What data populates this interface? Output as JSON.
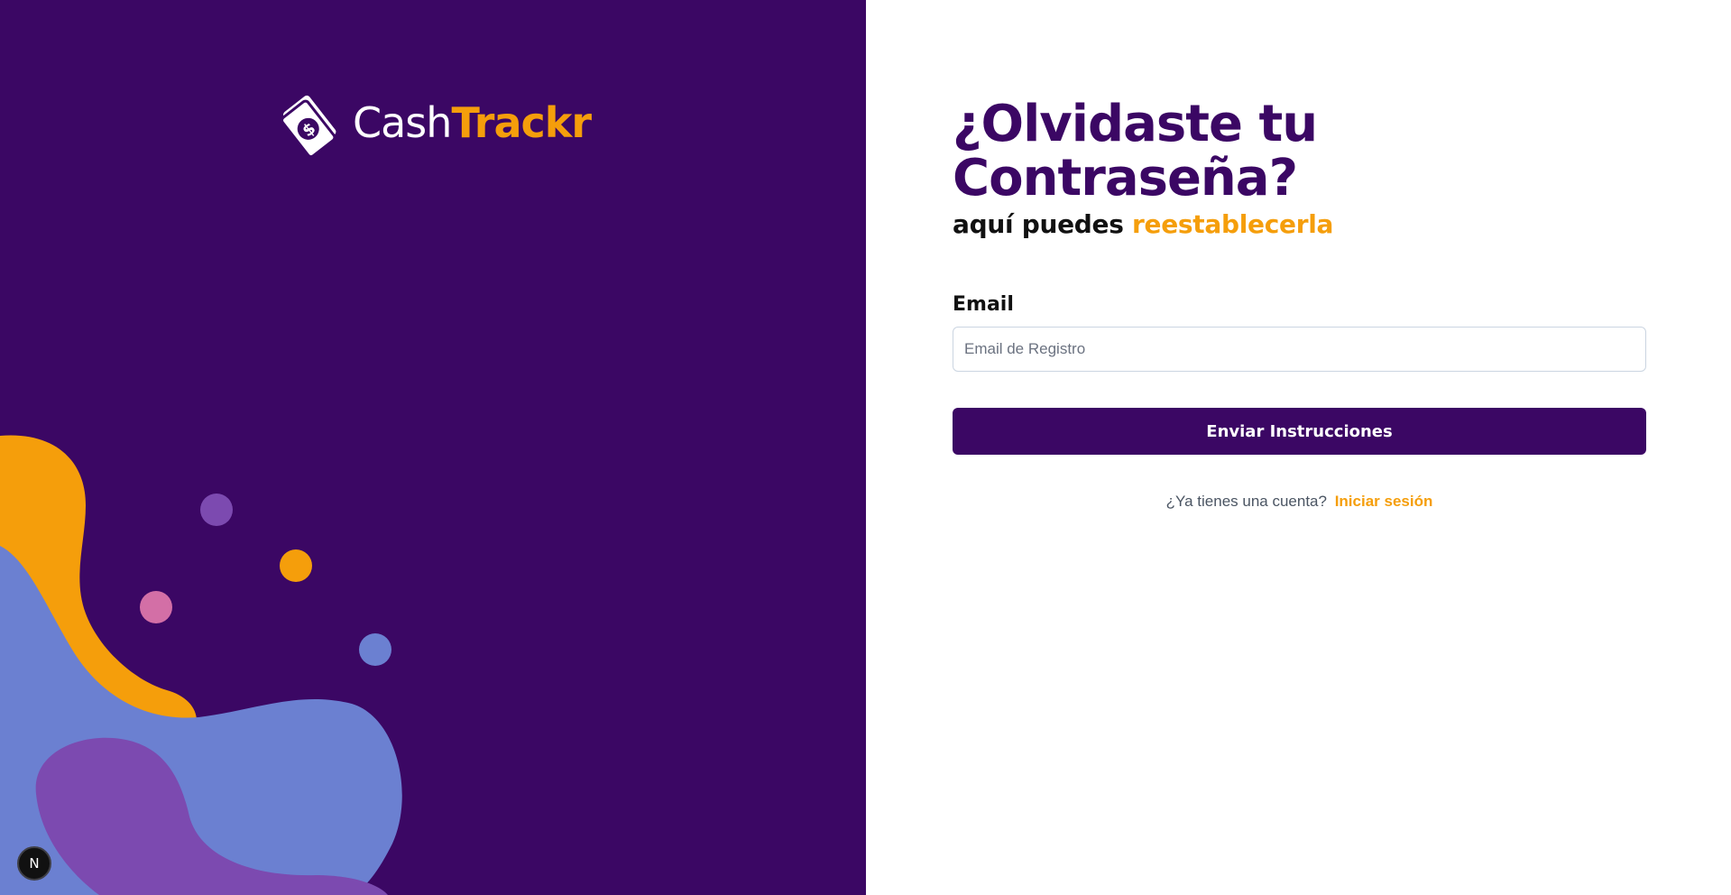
{
  "brand": {
    "name_part1": "Cash",
    "name_part2": "Trackr",
    "primary_color": "#3b0764",
    "accent_color": "#f59e0b",
    "logo_icon": "money-bill-dollar-icon"
  },
  "form": {
    "title": "¿Olvidaste tu Contraseña?",
    "subtitle_prefix": "aquí puedes",
    "subtitle_accent": "reestablecerla",
    "email_label": "Email",
    "email_placeholder": "Email de Registro",
    "email_value": "",
    "submit_label": "Enviar Instrucciones",
    "login_prompt": "¿Ya tienes una cuenta?",
    "login_link": "Iniciar sesión"
  },
  "dev_badge": {
    "icon": "nextjs-icon",
    "text": "N"
  }
}
